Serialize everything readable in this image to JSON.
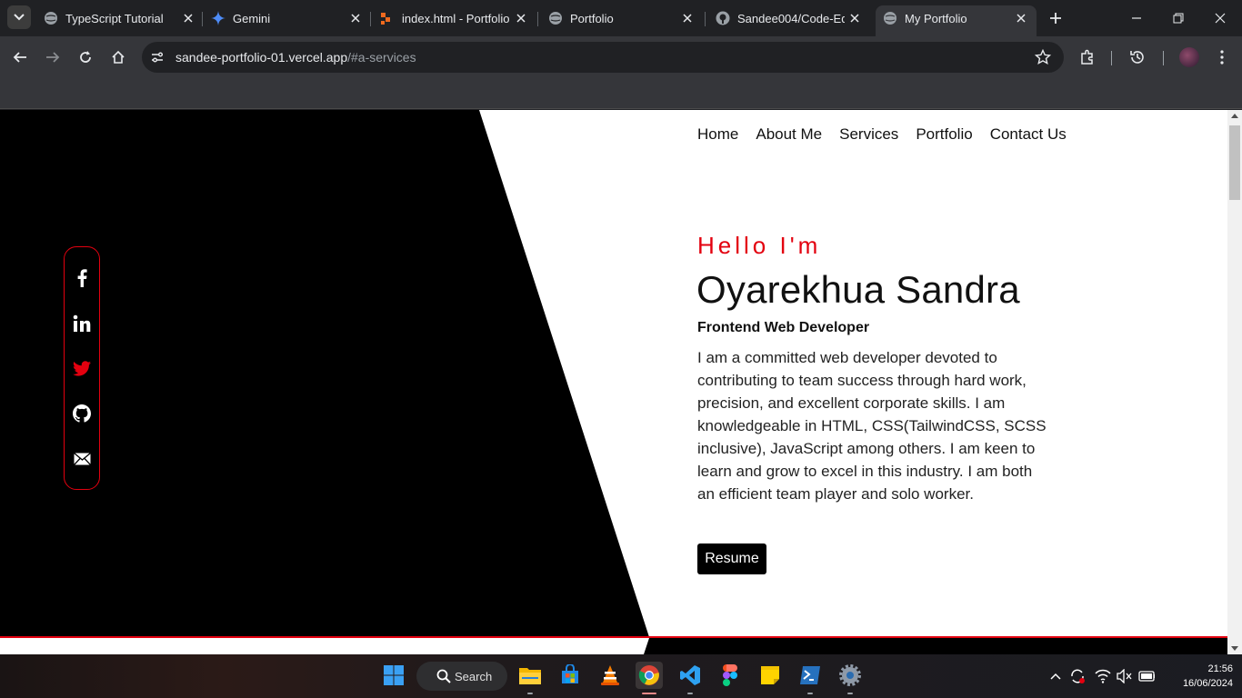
{
  "browser": {
    "tabs": [
      {
        "title": "TypeScript Tutorial",
        "icon": "globe-icon",
        "active": false
      },
      {
        "title": "Gemini",
        "icon": "gemini-icon",
        "active": false
      },
      {
        "title": "index.html - Portfolio",
        "icon": "codepen-icon",
        "active": false
      },
      {
        "title": "Portfolio",
        "icon": "globe-icon",
        "active": false
      },
      {
        "title": "Sandee004/Code-Edi",
        "icon": "github-icon",
        "active": false
      },
      {
        "title": "My Portfolio",
        "icon": "globe-icon",
        "active": true
      }
    ],
    "address": {
      "domain": "sandee-portfolio-01.vercel.app",
      "path": "/#a-services"
    }
  },
  "page": {
    "nav": [
      "Home",
      "About Me",
      "Services",
      "Portfolio",
      "Contact Us"
    ],
    "social": [
      "facebook-icon",
      "linkedin-icon",
      "twitter-icon",
      "github-icon",
      "mail-icon"
    ],
    "hero": {
      "greeting": "Hello I'm",
      "name": "Oyarekhua Sandra",
      "role": "Frontend Web Developer",
      "bio": "I am a committed web developer devoted to contributing to team success through hard work, precision, and excellent corporate skills. I am knowledgeable in HTML, CSS(TailwindCSS, SCSS inclusive), JavaScript among others. I am keen to learn and grow to excel in this industry. I am both an efficient team player and solo worker.",
      "resume_label": "Resume"
    },
    "colors": {
      "accent": "#e3000f",
      "dark": "#000000",
      "light": "#ffffff"
    }
  },
  "taskbar": {
    "search_label": "Search",
    "apps": [
      "windows-start-icon",
      "file-explorer-icon",
      "microsoft-store-icon",
      "vlc-icon",
      "chrome-icon",
      "vscode-icon",
      "figma-icon",
      "sticky-notes-icon",
      "powershell-icon",
      "settings-icon"
    ],
    "clock": {
      "time": "21:56",
      "date": "16/06/2024"
    }
  }
}
